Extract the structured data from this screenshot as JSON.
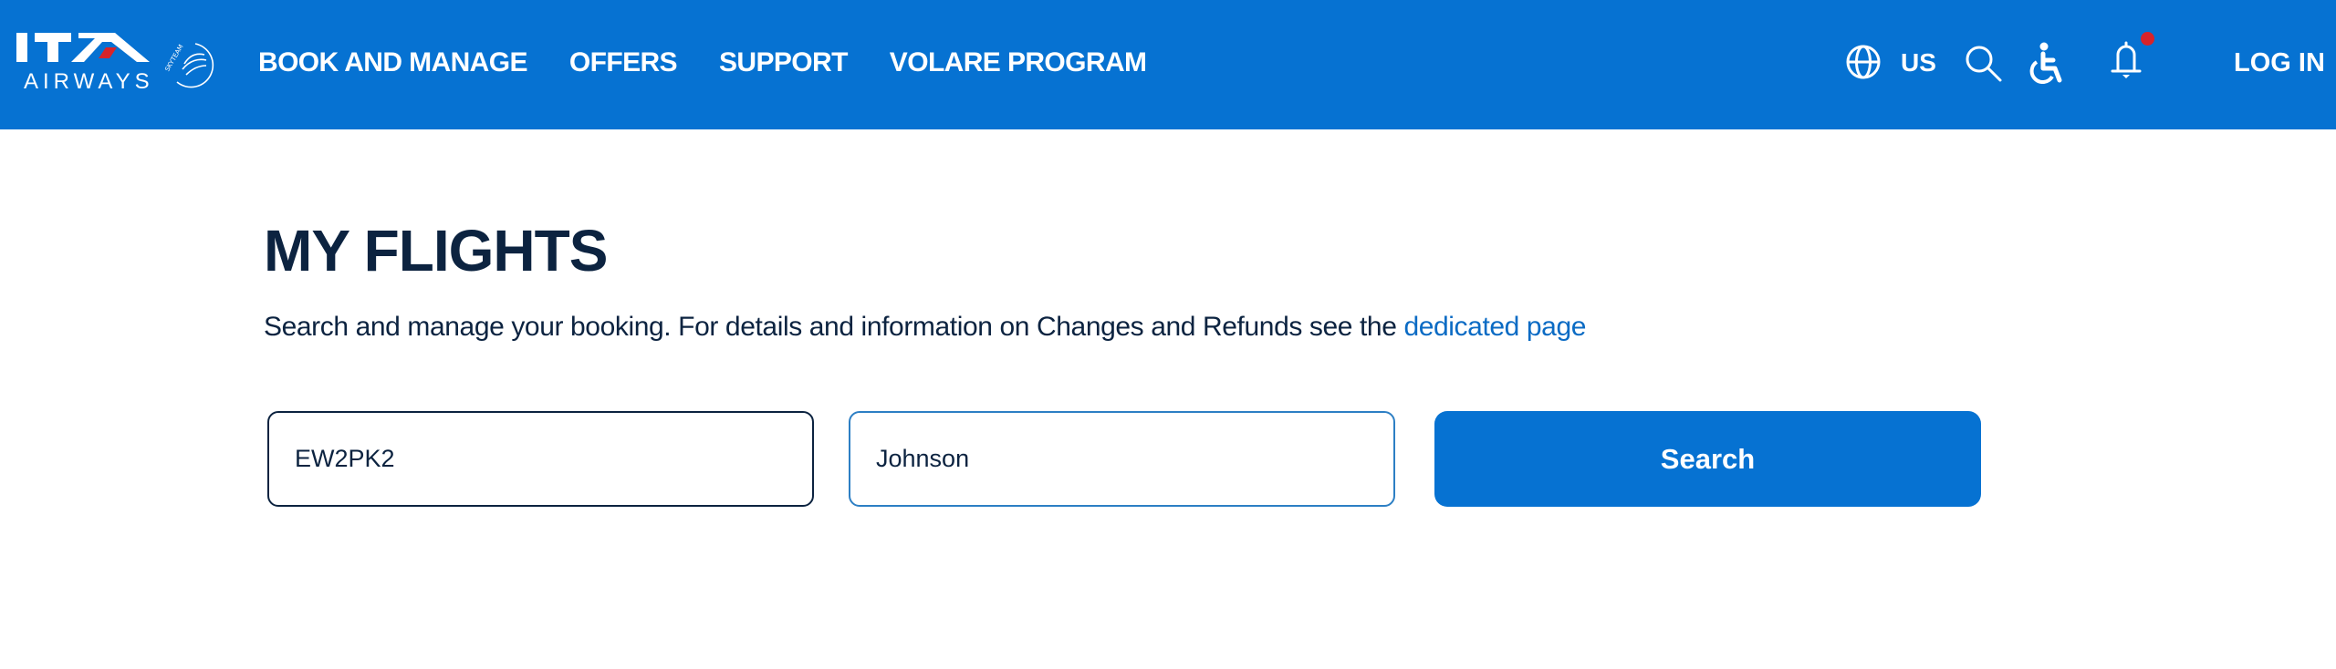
{
  "header": {
    "brand": {
      "logo_text": "ITA",
      "logo_subtitle": "AIRWAYS",
      "alliance": "SKYTEAM",
      "accent_color": "#d8232a",
      "background_color": "#0672d2"
    },
    "nav": [
      {
        "label": "BOOK AND MANAGE"
      },
      {
        "label": "OFFERS"
      },
      {
        "label": "SUPPORT"
      },
      {
        "label": "VOLARE PROGRAM"
      }
    ],
    "tools": {
      "language_icon": "globe-icon",
      "language_label": "US",
      "search_icon": "search-icon",
      "accessibility_icon": "accessibility-icon",
      "notifications_icon": "bell-icon",
      "notifications_badge": true,
      "login_label": "LOG IN"
    }
  },
  "main": {
    "title": "MY FLIGHTS",
    "description": "Search and manage your booking. For details and information on Changes and Refunds see the ",
    "description_link": "dedicated page",
    "form": {
      "booking_code_value": "EW2PK2",
      "last_name_value": "Johnson",
      "search_label": "Search"
    }
  }
}
